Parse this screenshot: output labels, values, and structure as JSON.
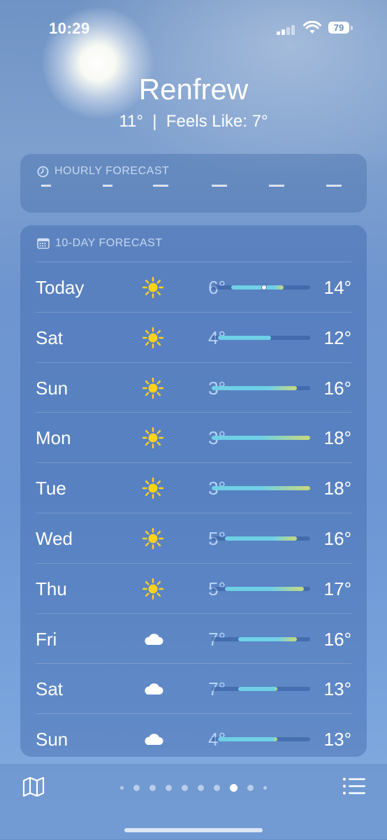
{
  "status_bar": {
    "time": "10:29",
    "battery": "79"
  },
  "location": {
    "city": "Renfrew",
    "current_temp": "11°",
    "separator": "|",
    "feels_like": "Feels Like: 7°"
  },
  "hourly": {
    "header": "HOURLY FORECAST",
    "icon": "clock-icon"
  },
  "daily": {
    "header": "10-DAY FORECAST",
    "icon": "calendar-icon",
    "scale": {
      "min": 3,
      "max": 18
    },
    "days": [
      {
        "day": "Today",
        "icon": "sun-icon",
        "low": "6°",
        "high": "14°",
        "low_value": 6,
        "high_value": 14,
        "current_value": 11
      },
      {
        "day": "Sat",
        "icon": "sun-icon",
        "low": "4°",
        "high": "12°",
        "low_value": 4,
        "high_value": 12
      },
      {
        "day": "Sun",
        "icon": "sun-icon",
        "low": "3°",
        "high": "16°",
        "low_value": 3,
        "high_value": 16
      },
      {
        "day": "Mon",
        "icon": "sun-icon",
        "low": "3°",
        "high": "18°",
        "low_value": 3,
        "high_value": 18
      },
      {
        "day": "Tue",
        "icon": "sun-icon",
        "low": "3°",
        "high": "18°",
        "low_value": 3,
        "high_value": 18
      },
      {
        "day": "Wed",
        "icon": "sun-icon",
        "low": "5°",
        "high": "16°",
        "low_value": 5,
        "high_value": 16
      },
      {
        "day": "Thu",
        "icon": "sun-icon",
        "low": "5°",
        "high": "17°",
        "low_value": 5,
        "high_value": 17
      },
      {
        "day": "Fri",
        "icon": "cloud-icon",
        "low": "7°",
        "high": "16°",
        "low_value": 7,
        "high_value": 16
      },
      {
        "day": "Sat",
        "icon": "cloud-icon",
        "low": "7°",
        "high": "13°",
        "low_value": 7,
        "high_value": 13
      },
      {
        "day": "Sun",
        "icon": "cloud-icon",
        "low": "4°",
        "high": "13°",
        "low_value": 4,
        "high_value": 13
      }
    ]
  },
  "toolbar": {
    "map_icon": "map-icon",
    "list_icon": "list-icon",
    "page_count": 10,
    "active_page": 8
  },
  "colors": {
    "cool": "#6fd0e6",
    "warm": "#c9d97a",
    "sun": "#ffd21a"
  }
}
